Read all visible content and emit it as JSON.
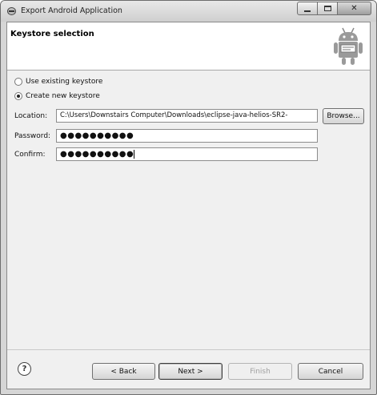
{
  "window": {
    "title": "Export Android Application"
  },
  "banner": {
    "title": "Keystore selection"
  },
  "options": {
    "use_existing": "Use existing keystore",
    "create_new": "Create new keystore",
    "selected": "create_new"
  },
  "location": {
    "label": "Location:",
    "value": "C:\\Users\\Downstairs Computer\\Downloads\\eclipse-java-helios-SR2-",
    "browse_label": "Browse..."
  },
  "password": {
    "label": "Password:",
    "value": "●●●●●●●●●●"
  },
  "confirm": {
    "label": "Confirm:",
    "value": "●●●●●●●●●●"
  },
  "buttons": {
    "back": "< Back",
    "next": "Next >",
    "finish": "Finish",
    "cancel": "Cancel"
  },
  "icons": {
    "help": "?",
    "close": "✕",
    "app_icon": "eclipse-icon",
    "banner_icon": "android-robot-icon"
  }
}
